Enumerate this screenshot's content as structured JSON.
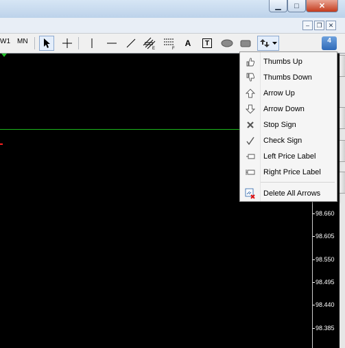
{
  "window": {
    "buttons": {
      "minimize": "▁",
      "maximize": "□",
      "close": "✕"
    },
    "mdi_buttons": {
      "minimize": "–",
      "restore": "❐",
      "close": "✕"
    }
  },
  "toolbar": {
    "timeframes": [
      "W1",
      "MN"
    ],
    "text_tool_label": "A",
    "textbox_tool_label": "T",
    "notification_badge": "4"
  },
  "price_axis": {
    "labels": [
      "98.660",
      "98.605",
      "98.550",
      "98.495",
      "98.440",
      "98.385"
    ]
  },
  "arrows_menu": {
    "items": [
      {
        "label": "Thumbs Up",
        "icon": "thumbs-up-icon"
      },
      {
        "label": "Thumbs Down",
        "icon": "thumbs-down-icon"
      },
      {
        "label": "Arrow Up",
        "icon": "arrow-up-icon"
      },
      {
        "label": "Arrow Down",
        "icon": "arrow-down-icon"
      },
      {
        "label": "Stop Sign",
        "icon": "stop-sign-icon"
      },
      {
        "label": "Check Sign",
        "icon": "check-sign-icon"
      },
      {
        "label": "Left Price Label",
        "icon": "left-price-label-icon"
      },
      {
        "label": "Right Price Label",
        "icon": "right-price-label-icon"
      },
      {
        "label": "Delete All Arrows",
        "icon": "delete-arrows-icon"
      }
    ]
  },
  "colors": {
    "chart_background": "#000000",
    "horizontal_line": "#1db81d",
    "accent": "#2f6ab8"
  }
}
